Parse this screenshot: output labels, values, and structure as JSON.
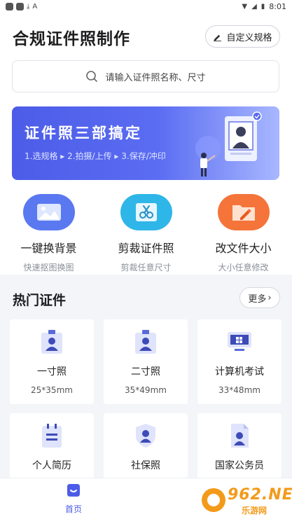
{
  "status_bar": {
    "time": "8:01"
  },
  "header": {
    "title": "合规证件照制作",
    "custom_button_label": "自定义规格"
  },
  "search": {
    "placeholder": "请输入证件照名称、尺寸"
  },
  "banner": {
    "title": "证件照三部搞定",
    "steps": "1.选规格 ▸ 2.拍摄/上传 ▸ 3.保存/冲印"
  },
  "features": [
    {
      "name": "一键换背景",
      "sub": "快速抠图换图",
      "icon": "image-icon",
      "color": "#5a78f0"
    },
    {
      "name": "剪裁证件照",
      "sub": "剪裁任意尺寸",
      "icon": "scissors-icon",
      "color": "#2fb6e8"
    },
    {
      "name": "改文件大小",
      "sub": "大小任意修改",
      "icon": "folder-edit-icon",
      "color": "#f5743a"
    }
  ],
  "section": {
    "title": "热门证件",
    "more_label": "更多"
  },
  "cards": [
    {
      "name": "一寸照",
      "size": "25*35mm",
      "icon": "id-badge-icon"
    },
    {
      "name": "二寸照",
      "size": "35*49mm",
      "icon": "id-badge-icon"
    },
    {
      "name": "计算机考试",
      "size": "33*48mm",
      "icon": "computer-icon"
    },
    {
      "name": "个人简历",
      "size": "",
      "icon": "resume-icon"
    },
    {
      "name": "社保照",
      "size": "",
      "icon": "shield-user-icon"
    },
    {
      "name": "国家公务员",
      "size": "",
      "icon": "document-user-icon"
    }
  ],
  "bottom_nav": {
    "home_label": "首页"
  },
  "watermark": {
    "text": "962.NET",
    "sub": "乐游网"
  },
  "colors": {
    "accent": "#4c5ce8",
    "icon_tint": "#5b6bd6"
  }
}
